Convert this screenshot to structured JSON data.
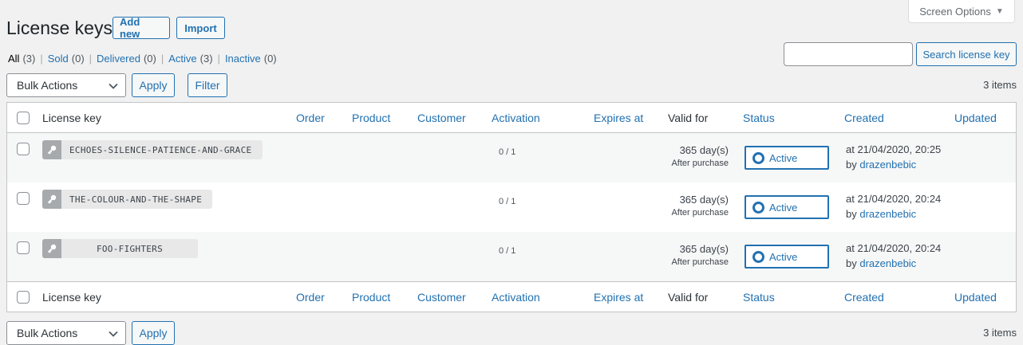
{
  "screen_options": {
    "label": "Screen Options"
  },
  "header": {
    "title": "License keys",
    "add_new": "Add new",
    "import": "Import"
  },
  "filters": [
    {
      "label": "All",
      "count": "(3)"
    },
    {
      "label": "Sold",
      "count": "(0)"
    },
    {
      "label": "Delivered",
      "count": "(0)"
    },
    {
      "label": "Active",
      "count": "(3)"
    },
    {
      "label": "Inactive",
      "count": "(0)"
    }
  ],
  "search": {
    "placeholder": "",
    "button": "Search license key"
  },
  "tablenav_top": {
    "bulk_actions": "Bulk Actions",
    "apply": "Apply",
    "filter": "Filter",
    "items": "3 items"
  },
  "tablenav_bottom": {
    "bulk_actions": "Bulk Actions",
    "apply": "Apply",
    "items": "3 items"
  },
  "columns": {
    "license_key": "License key",
    "order": "Order",
    "product": "Product",
    "customer": "Customer",
    "activation": "Activation",
    "expires_at": "Expires at",
    "valid_for": "Valid for",
    "status": "Status",
    "created": "Created",
    "updated": "Updated"
  },
  "rows": [
    {
      "key": "ECHOES-SILENCE-PATIENCE-AND-GRACE",
      "activation": "0 / 1",
      "days": "365 day(s)",
      "after": "After purchase",
      "status": "Active",
      "created_at": "at 21/04/2020, 20:25",
      "by": "by",
      "author": "drazenbebic"
    },
    {
      "key": "THE-COLOUR-AND-THE-SHAPE",
      "activation": "0 / 1",
      "days": "365 day(s)",
      "after": "After purchase",
      "status": "Active",
      "created_at": "at 21/04/2020, 20:24",
      "by": "by",
      "author": "drazenbebic"
    },
    {
      "key": "FOO-FIGHTERS",
      "activation": "0 / 1",
      "days": "365 day(s)",
      "after": "After purchase",
      "status": "Active",
      "created_at": "at 21/04/2020, 20:24",
      "by": "by",
      "author": "drazenbebic"
    }
  ],
  "colors": {
    "accent": "#2271b1",
    "background": "#f1f1f1",
    "row_alt": "#f6f7f7"
  },
  "icons": {
    "key": "key-icon",
    "status": "circle-icon",
    "dropdown": "chevron-down-icon",
    "screen_options": "caret-down-icon"
  }
}
